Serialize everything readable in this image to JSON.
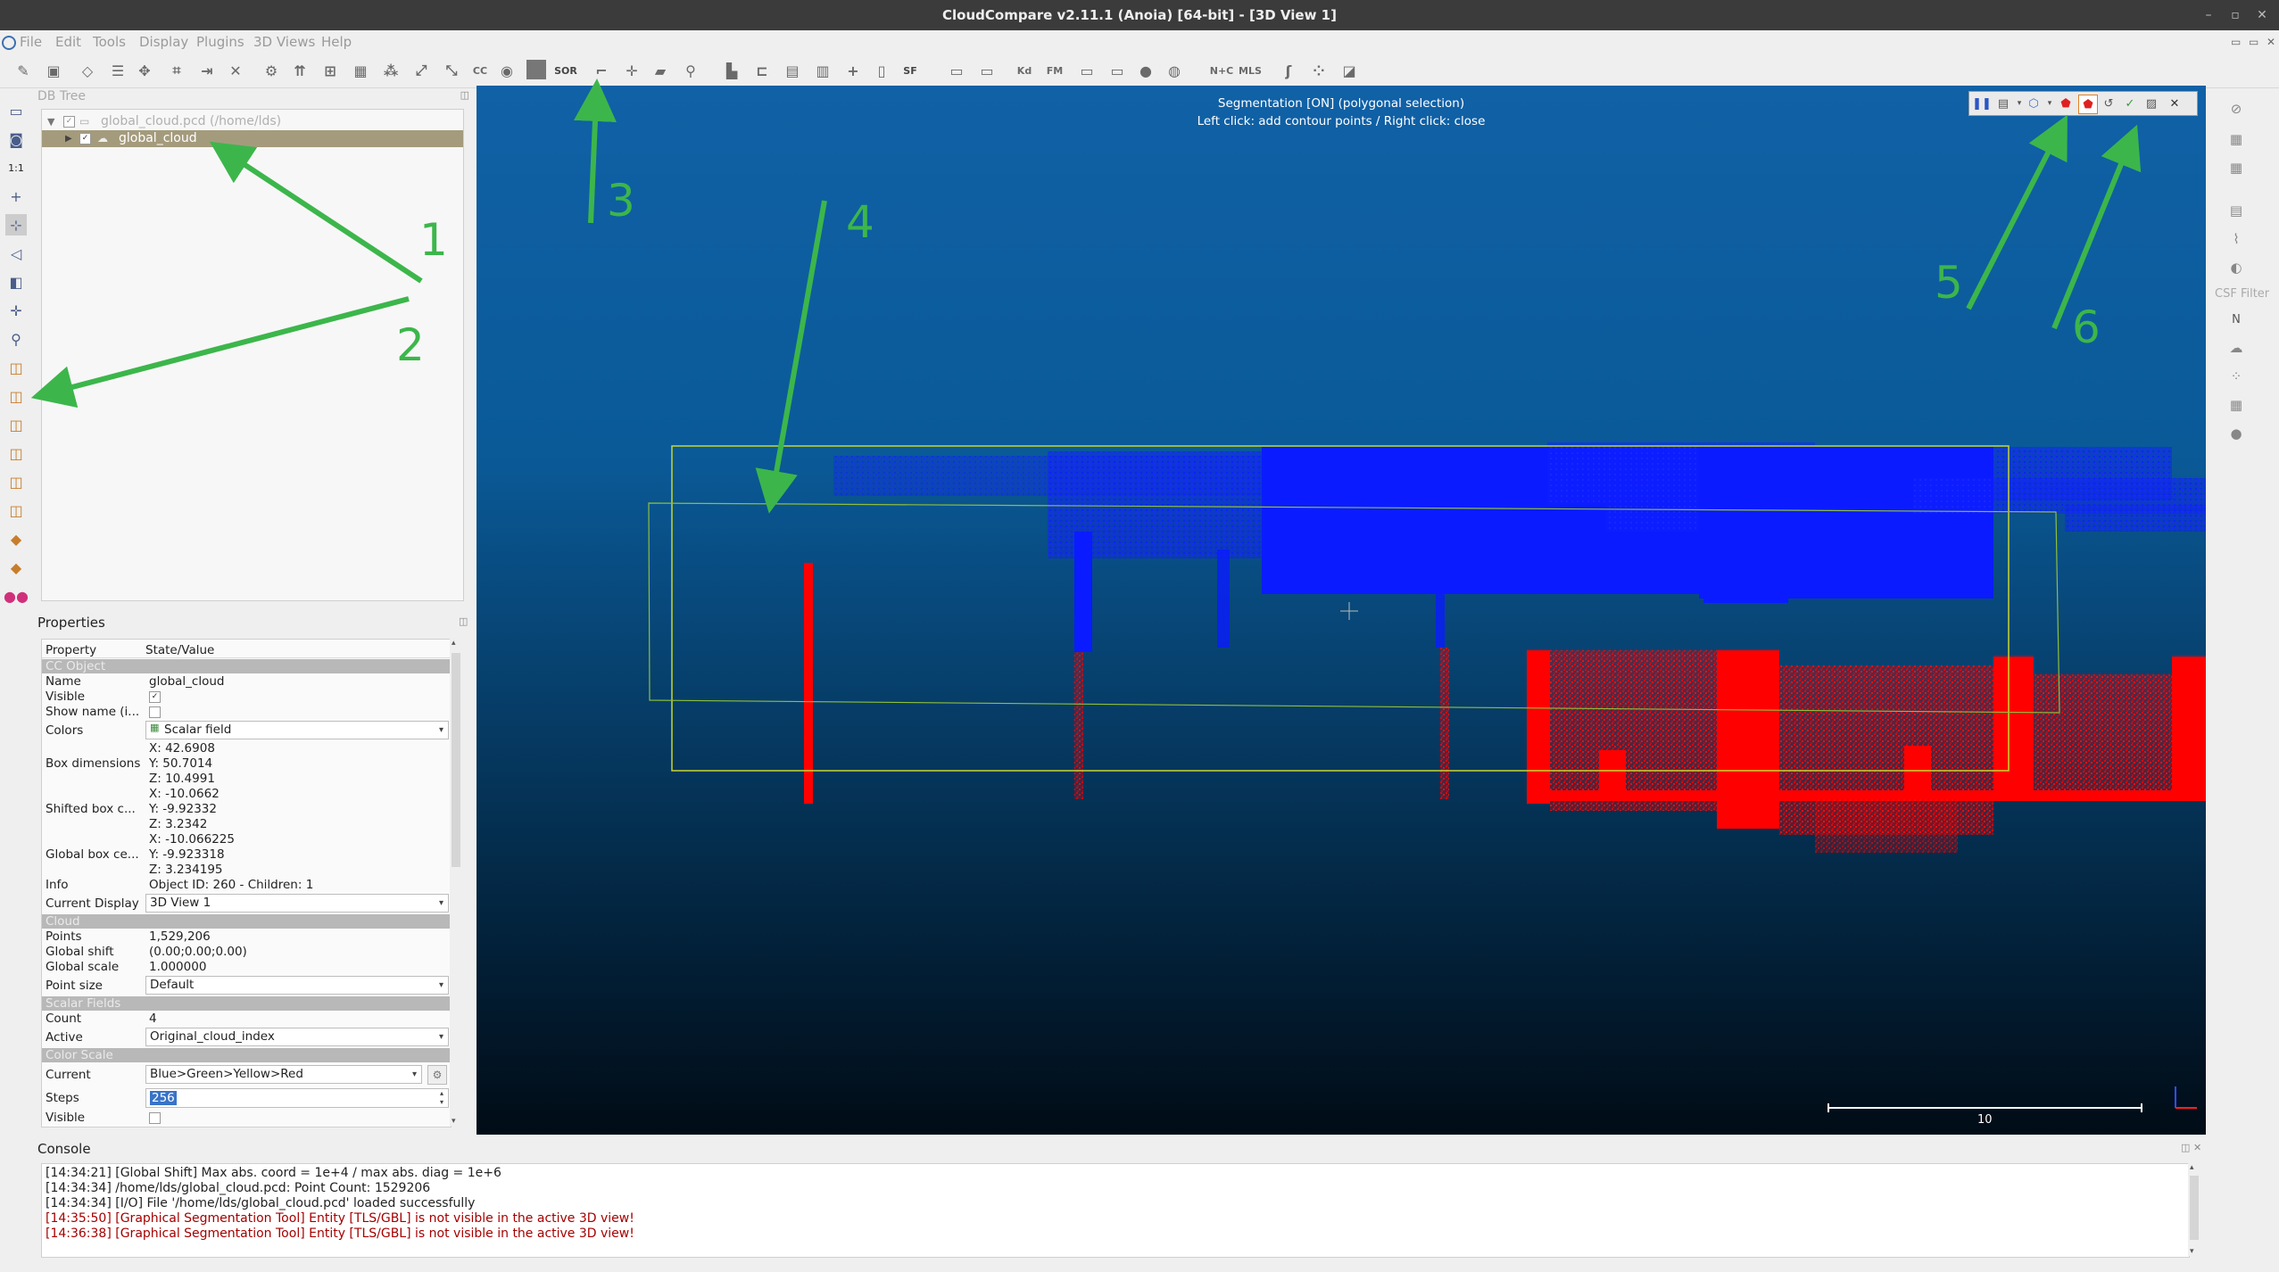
{
  "window": {
    "title": "CloudCompare v2.11.1 (Anoia) [64-bit] - [3D View 1]",
    "controls": [
      "–",
      "▫",
      "✕"
    ]
  },
  "menu": [
    "File",
    "Edit",
    "Tools",
    "Display",
    "Plugins",
    "3D Views",
    "Help"
  ],
  "toolbar": {
    "icons": [
      "edit-icon",
      "save-icon",
      "clone-icon",
      "list-icon",
      "translate-icon",
      "crop-icon",
      "merge-icon",
      "delete-icon",
      "sample-icon",
      "normals-icon",
      "octree-icon",
      "mesh-icon",
      "subsample-icon",
      "register-icon",
      "align-icon",
      "cc-icon",
      "segment-icon",
      "raster-icon",
      "sor-icon",
      "hook-icon",
      "move-icon",
      "plane-icon",
      "pick-icon",
      "histogram-icon",
      "sf-icon",
      "filter-icon",
      "gradient-icon",
      "add-icon",
      "sf-remove-icon",
      "sf-arith-icon",
      "cross-section-icon",
      "classify-icon",
      "kd-icon",
      "fm-icon",
      "box-icon",
      "slice-icon",
      "sphere-icon",
      "globe-icon",
      "mplus-icon",
      "mls-icon",
      "contour-icon",
      "sample2-icon",
      "plugin-icon"
    ],
    "sor_label": "SOR",
    "sf_label": "SF",
    "kd_label": "Kd",
    "fm_label": "FM",
    "nc_label": "N+C",
    "mls_label": "MLS",
    "cc_label": "CC"
  },
  "dbtree": {
    "header": "DB Tree",
    "root_label": "global_cloud.pcd (/home/lds)",
    "child_label": "global_cloud"
  },
  "properties": {
    "title": "Properties",
    "col_property": "Property",
    "col_value": "State/Value",
    "cc_object": "CC Object",
    "name_k": "Name",
    "name_v": "global_cloud",
    "visible_k": "Visible",
    "showname_k": "Show name (i...",
    "colors_k": "Colors",
    "colors_v": "Scalar field",
    "boxdim_k": "Box dimensions",
    "boxdim_x": "X: 42.6908",
    "boxdim_y": "Y: 50.7014",
    "boxdim_z": "Z: 10.4991",
    "shifted_k": "Shifted box c...",
    "shifted_x": "X: -10.0662",
    "shifted_y": "Y: -9.92332",
    "shifted_z": "Z: 3.2342",
    "global_k": "Global box ce...",
    "global_x": "X: -10.066225",
    "global_y": "Y: -9.923318",
    "global_z": "Z: 3.234195",
    "info_k": "Info",
    "info_v": "Object ID: 260 - Children: 1",
    "curdisp_k": "Current Display",
    "curdisp_v": "3D View 1",
    "cloud": "Cloud",
    "points_k": "Points",
    "points_v": "1,529,206",
    "gshift_k": "Global shift",
    "gshift_v": "(0.00;0.00;0.00)",
    "gscale_k": "Global scale",
    "gscale_v": "1.000000",
    "psize_k": "Point size",
    "psize_v": "Default",
    "scalar_fields": "Scalar Fields",
    "count_k": "Count",
    "count_v": "4",
    "active_k": "Active",
    "active_v": "Original_cloud_index",
    "color_scale": "Color Scale",
    "current_k": "Current",
    "current_v": "Blue>Green>Yellow>Red",
    "steps_k": "Steps",
    "steps_v": "256",
    "visible2_k": "Visible"
  },
  "view3d": {
    "seg_line1": "Segmentation [ON] (polygonal selection)",
    "seg_line2": "Left click: add contour points / Right click: close",
    "scale_label": "10"
  },
  "righttb": {
    "csf_label": "CSF Filter",
    "n_label": "N"
  },
  "console": {
    "title": "Console",
    "lines": [
      {
        "text": "[14:34:21] [Global Shift] Max abs. coord = 1e+4 / max abs. diag = 1e+6",
        "error": false
      },
      {
        "text": "[14:34:34] /home/lds/global_cloud.pcd: Point Count: 1529206",
        "error": false
      },
      {
        "text": "[14:34:34] [I/O] File '/home/lds/global_cloud.pcd' loaded successfully",
        "error": false
      },
      {
        "text": "[14:35:50] [Graphical Segmentation Tool] Entity [TLS/GBL] is not visible in the active 3D view!",
        "error": true
      },
      {
        "text": "[14:36:38] [Graphical Segmentation Tool] Entity [TLS/GBL] is not visible in the active 3D view!",
        "error": true
      }
    ]
  },
  "annotations": [
    "1",
    "2",
    "3",
    "4",
    "5",
    "6"
  ],
  "colors": {
    "arrow": "#3cb64b",
    "bbox": "#c8d630",
    "points_blue": "#0a1cff",
    "points_red": "#ff0000"
  }
}
